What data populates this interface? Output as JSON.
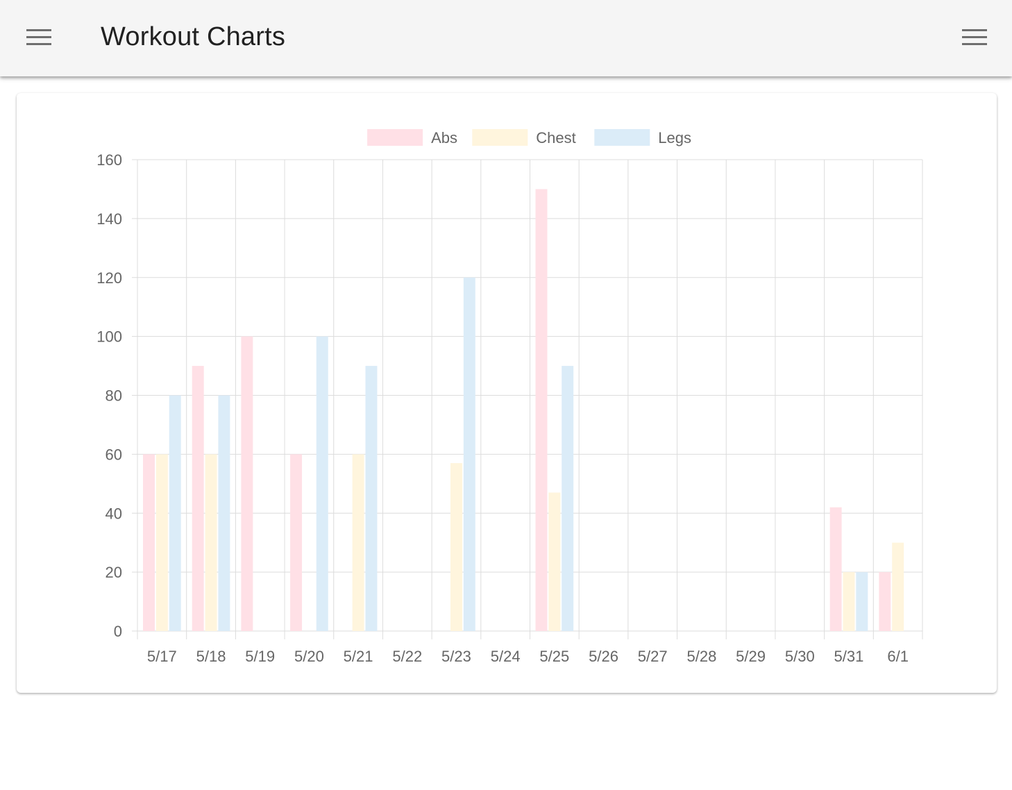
{
  "app_bar": {
    "title": "Workout Charts",
    "left_icon": "menu-icon",
    "right_icon": "menu-icon",
    "background": "#f5f5f5"
  },
  "chart_data": {
    "type": "bar",
    "categories": [
      "5/17",
      "5/18",
      "5/19",
      "5/20",
      "5/21",
      "5/22",
      "5/23",
      "5/24",
      "5/25",
      "5/26",
      "5/27",
      "5/28",
      "5/29",
      "5/30",
      "5/31",
      "6/1"
    ],
    "series": [
      {
        "name": "Abs",
        "color": "#ffe0e6",
        "values": [
          60,
          90,
          100,
          60,
          null,
          null,
          null,
          null,
          150,
          null,
          null,
          null,
          null,
          null,
          42,
          20
        ]
      },
      {
        "name": "Chest",
        "color": "#fff5dd",
        "values": [
          60,
          60,
          null,
          null,
          60,
          null,
          57,
          null,
          47,
          null,
          null,
          null,
          null,
          null,
          20,
          30
        ]
      },
      {
        "name": "Legs",
        "color": "#dbecf8",
        "values": [
          80,
          80,
          null,
          100,
          90,
          null,
          120,
          null,
          90,
          null,
          null,
          null,
          null,
          null,
          20,
          null
        ]
      }
    ],
    "ylim": [
      0,
      160
    ],
    "yticks": [
      0,
      20,
      40,
      60,
      80,
      100,
      120,
      140,
      160
    ],
    "grid": true,
    "legend_position": "top-center",
    "title": "",
    "xlabel": "",
    "ylabel": ""
  }
}
